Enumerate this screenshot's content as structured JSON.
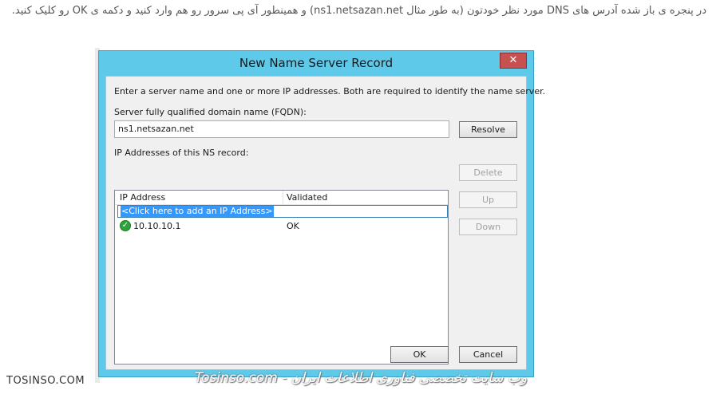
{
  "article": {
    "instruction": "در پنجره ی باز شده آدرس های DNS مورد نظر خودتون (به طور مثال ns1.netsazan.net) و همینطور آی پی سرور رو هم وارد کنید و دکمه ی OK رو کلیک کنید."
  },
  "dialog": {
    "title": "New Name Server Record",
    "close_glyph": "✕",
    "intro": "Enter a server name and one or more IP addresses.  Both are required to identify the name server.",
    "fqdn_label": "Server fully qualified domain name (FQDN):",
    "fqdn_value": "ns1.netsazan.net",
    "resolve_label": "Resolve",
    "ip_section_label": "IP Addresses of this NS record:",
    "columns": [
      "IP Address",
      "Validated"
    ],
    "add_row_text": "<Click here to add an IP Address>",
    "rows": [
      {
        "ip": "10.10.10.1",
        "validated": "OK",
        "icon": "check-ok-icon"
      }
    ],
    "delete_label": "Delete",
    "up_label": "Up",
    "down_label": "Down",
    "ok_label": "OK",
    "cancel_label": "Cancel"
  },
  "footer": {
    "site": "TOSINSO.COM",
    "watermark": "وب سایت تخصصی فناوری اطلاعات ایران - Tosinso.com"
  },
  "colors": {
    "title_bar": "#5fc9ea",
    "close_button": "#c75050",
    "selection": "#3399ff",
    "ok_icon": "#2fa33b"
  }
}
